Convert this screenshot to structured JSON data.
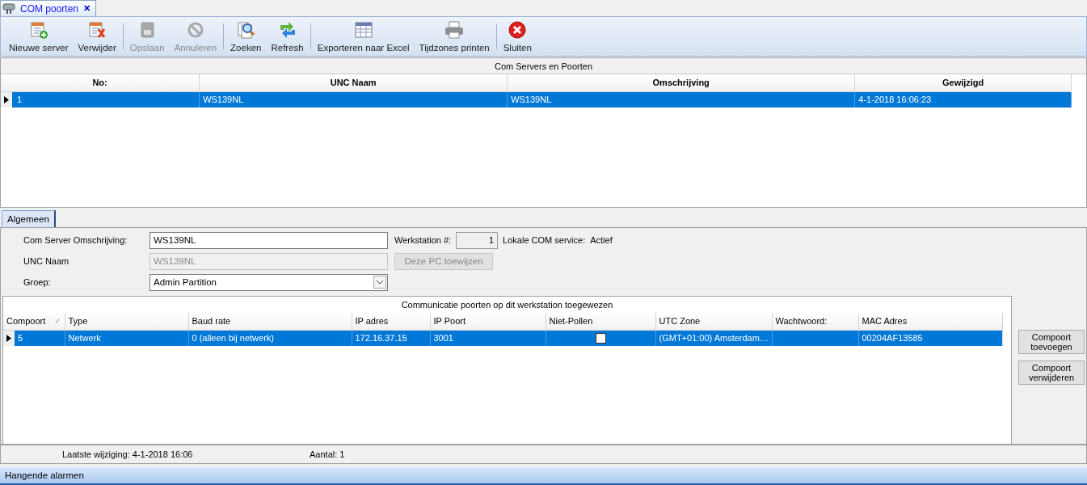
{
  "document_tab": {
    "title": "COM poorten",
    "close": "✕"
  },
  "toolbar": [
    [
      {
        "label": "Nieuwe server",
        "kind": "new",
        "disabled": false
      },
      {
        "label": "Verwijder",
        "kind": "delete",
        "disabled": false
      }
    ],
    [
      {
        "label": "Opslaan",
        "kind": "save",
        "disabled": true
      },
      {
        "label": "Annuleren",
        "kind": "cancel",
        "disabled": true
      }
    ],
    [
      {
        "label": "Zoeken",
        "kind": "search",
        "disabled": false
      },
      {
        "label": "Refresh",
        "kind": "refresh",
        "disabled": false
      }
    ],
    [
      {
        "label": "Exporteren naar Excel",
        "kind": "grid",
        "disabled": false
      },
      {
        "label": "Tijdzones printen",
        "kind": "print",
        "disabled": false
      }
    ],
    [
      {
        "label": "Sluiten",
        "kind": "close",
        "disabled": false
      }
    ]
  ],
  "servers_table": {
    "caption": "Com Servers en Poorten",
    "columns": [
      "No:",
      "UNC Naam",
      "Omschrijving",
      "Gewijzigd"
    ],
    "rows": [
      {
        "cells": [
          "1",
          "WS139NL",
          "WS139NL",
          "4-1-2018 16:06:23"
        ],
        "selected": true
      }
    ]
  },
  "detail_tabs": [
    {
      "label": "Algemeen",
      "selected": true
    }
  ],
  "form": {
    "omschrijving_label": "Com Server Omschrijving:",
    "omschrijving_value": "WS139NL",
    "werkstation_label": "Werkstation #:",
    "werkstation_value": "1",
    "service_label": "Lokale COM service:",
    "service_value": "Actief",
    "unc_label": "UNC Naam",
    "unc_value": "WS139NL",
    "assign_button": "Deze PC toewijzen",
    "assign_disabled": true,
    "groep_label": "Groep:",
    "groep_value": "Admin Partition"
  },
  "ports_table": {
    "caption": "Communicatie poorten op dit werkstation toegewezen",
    "columns": [
      {
        "label": "Compoort",
        "sorted": true
      },
      {
        "label": "Type",
        "sorted": false
      },
      {
        "label": "Baud rate",
        "sorted": false
      },
      {
        "label": "IP adres",
        "sorted": false
      },
      {
        "label": "IP Poort",
        "sorted": false
      },
      {
        "label": "Niet-Pollen",
        "sorted": false
      },
      {
        "label": "UTC Zone",
        "sorted": false
      },
      {
        "label": "Wachtwoord:",
        "sorted": false
      },
      {
        "label": "MAC Adres",
        "sorted": false
      }
    ],
    "rows": [
      {
        "selected": true,
        "compoort": "5",
        "type": "Netwerk",
        "baud_rate": "0 (alleen bij netwerk)",
        "ip_adres": "172.16.37.15",
        "ip_poort": "3001",
        "niet_pollen": false,
        "utc_zone": "(GMT+01:00)  Amsterdam…",
        "wachtwoord": "",
        "mac_adres": "00204AF13585"
      }
    ]
  },
  "side_buttons": [
    "Compoort toevoegen",
    "Compoort verwijderen"
  ],
  "status_bar": {
    "laatste_wijziging": "Laatste wijziging: 4-1-2018 16:06",
    "aantal": "Aantal: 1"
  },
  "alarm_bar": {
    "title": "Hangende alarmen"
  }
}
